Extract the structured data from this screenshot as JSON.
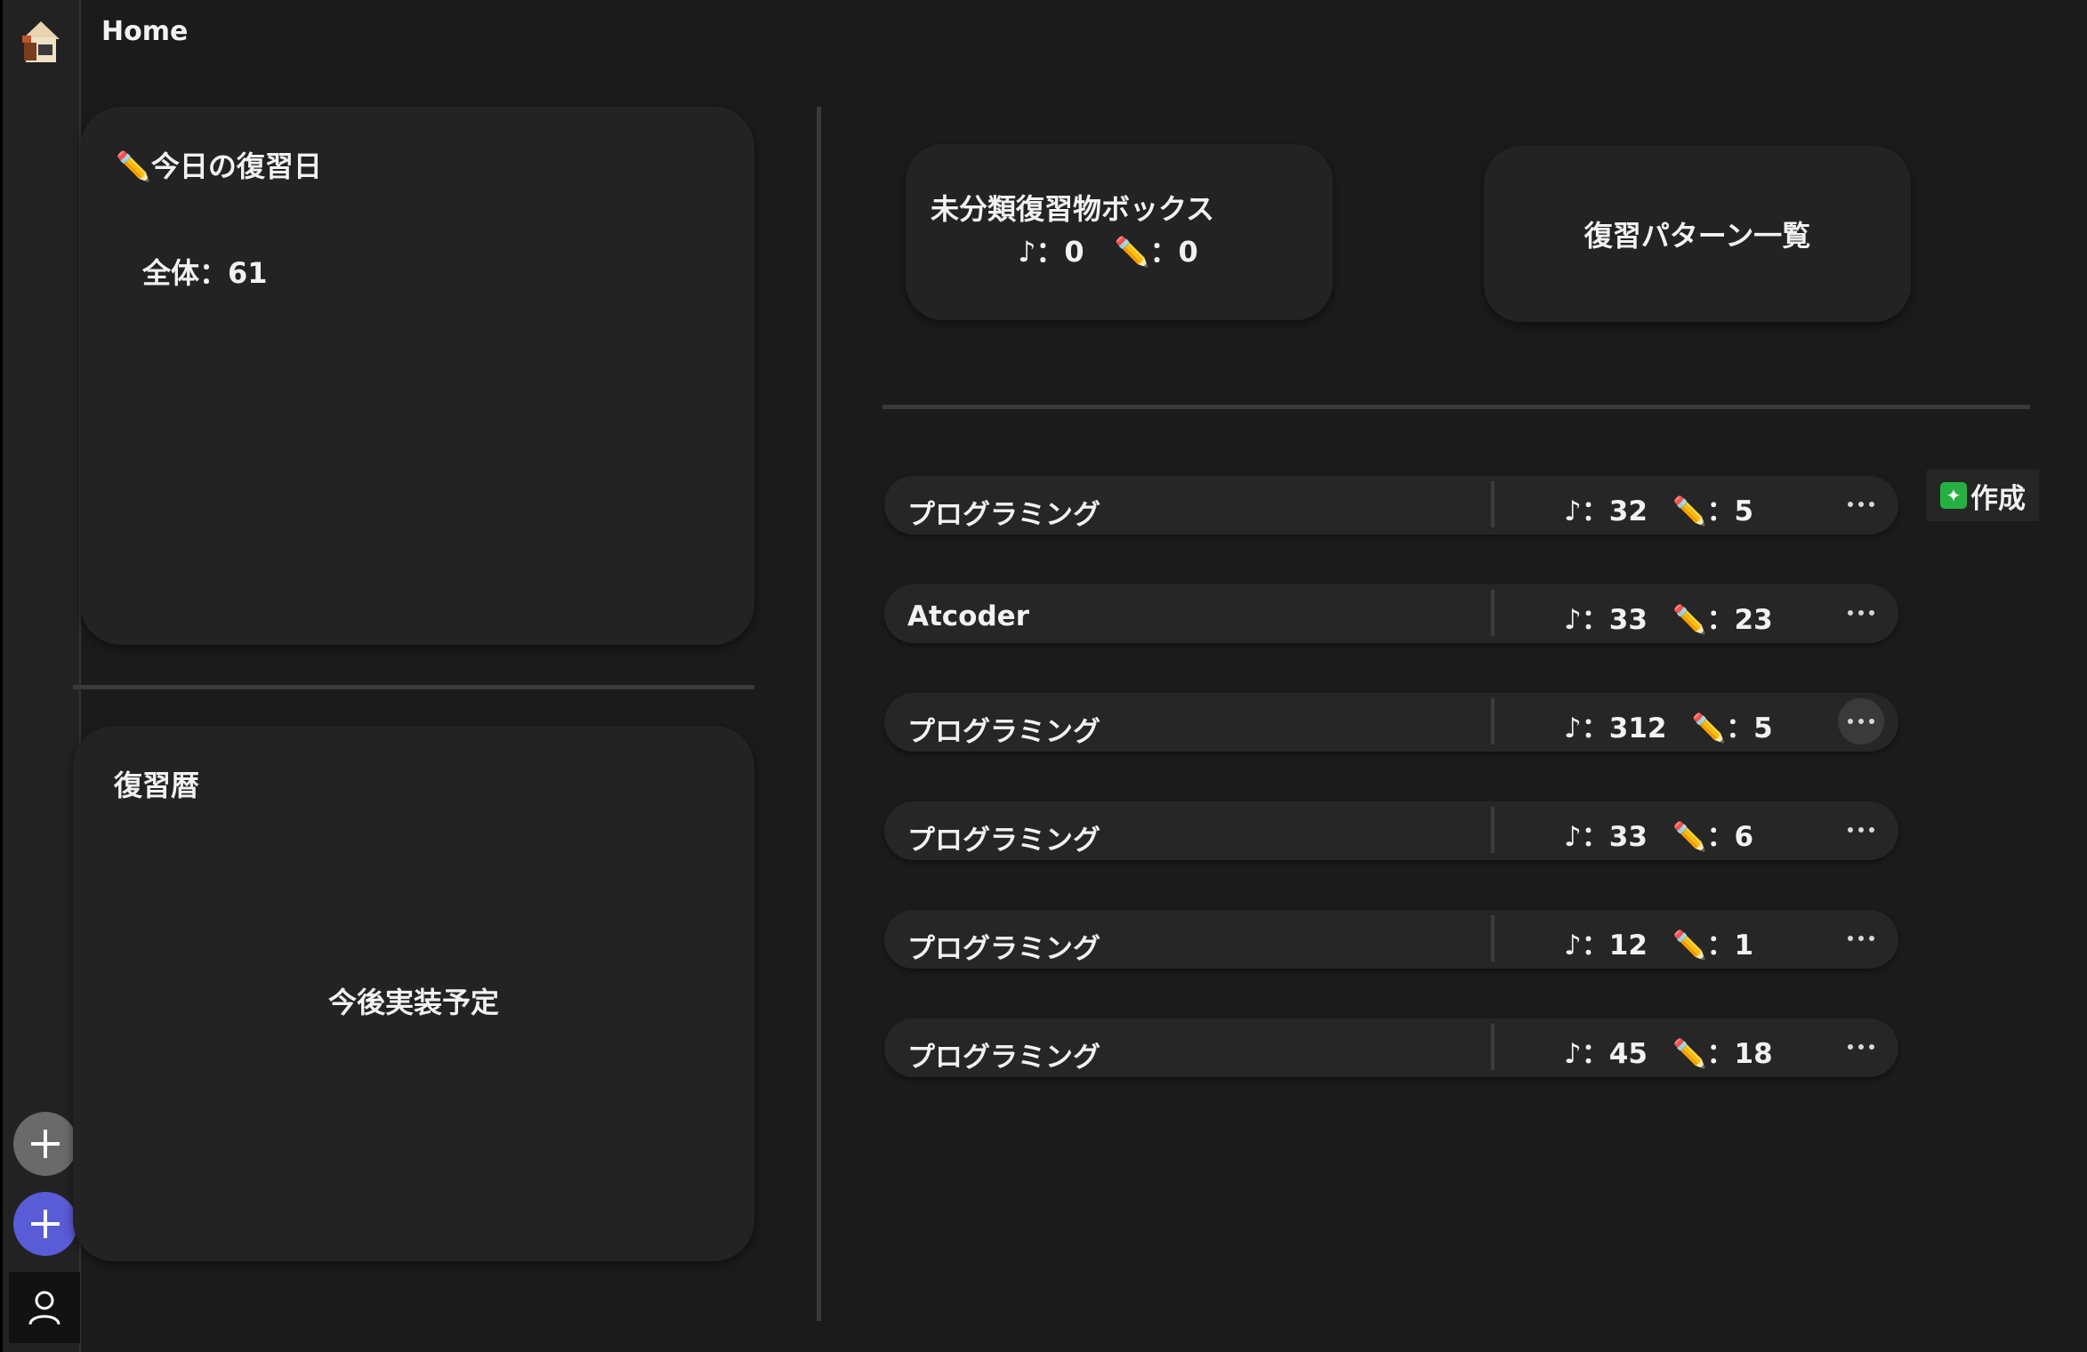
{
  "header": {
    "title": "Home"
  },
  "sidebar": {
    "logo_icon": "house-icon",
    "add_gray_icon": "plus-icon",
    "add_blue_icon": "plus-icon",
    "account_icon": "user-icon"
  },
  "today_card": {
    "title": "✏️今日の復習日",
    "total": "全体：61"
  },
  "history_card": {
    "title": "復習暦",
    "placeholder": "今後実装予定"
  },
  "uncategorized_box": {
    "title": "未分類復習物ボックス",
    "music_count": "♪：0",
    "pencil_count": "✏️：0"
  },
  "patterns_box": {
    "label": "復習パターン一覧"
  },
  "create_button": {
    "icon": "✦",
    "label": "作成"
  },
  "rows": [
    {
      "name": "プログラミング",
      "music": "♪：32",
      "pencil": "✏️：5"
    },
    {
      "name": "Atcoder",
      "music": "♪：33",
      "pencil": "✏️：23"
    },
    {
      "name": "プログラミング",
      "music": "♪：312",
      "pencil": "✏️：5"
    },
    {
      "name": "プログラミング",
      "music": "♪：33",
      "pencil": "✏️：6"
    },
    {
      "name": "プログラミング",
      "music": "♪：12",
      "pencil": "✏️：1"
    },
    {
      "name": "プログラミング",
      "music": "♪：45",
      "pencil": "✏️：18"
    }
  ],
  "colors": {
    "background": "#1b1b1b",
    "card": "#232323",
    "accent_blue": "#5a5bd6",
    "create_green": "#27b042"
  }
}
